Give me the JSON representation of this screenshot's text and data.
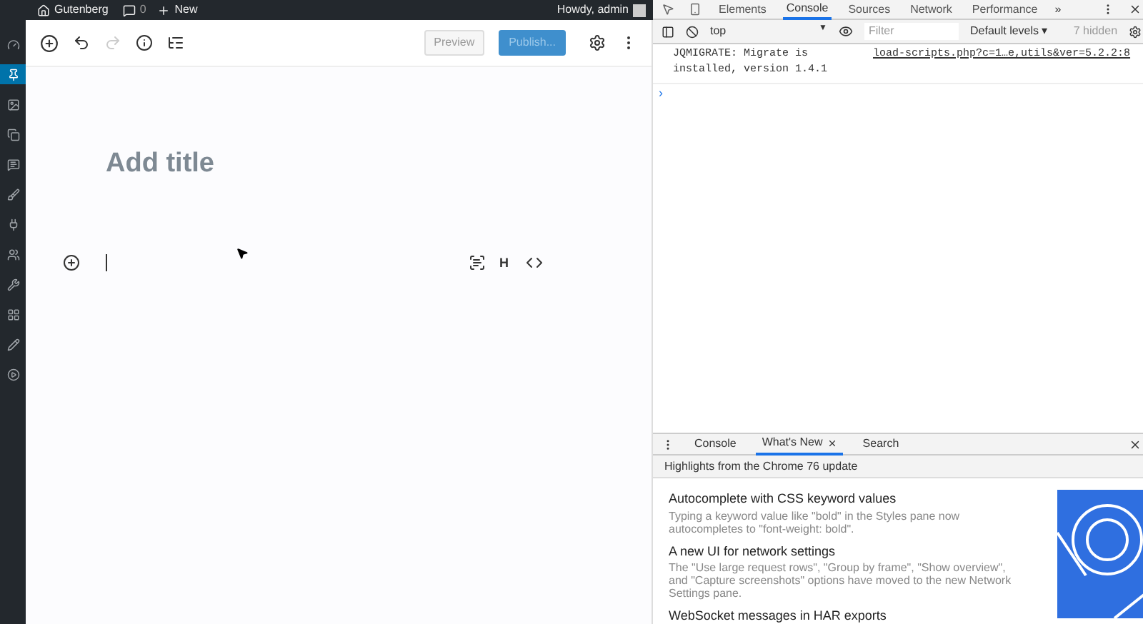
{
  "admin_bar": {
    "site": "Gutenberg",
    "comments": "0",
    "new": "New",
    "greeting": "Howdy, admin"
  },
  "sidebar": {
    "items": [
      {
        "selected": false
      },
      {
        "selected": true
      },
      {
        "selected": false
      },
      {
        "selected": false
      },
      {
        "selected": false
      },
      {
        "selected": false
      },
      {
        "selected": false
      },
      {
        "selected": false
      },
      {
        "selected": false
      },
      {
        "selected": false
      },
      {
        "selected": false
      },
      {
        "selected": false
      }
    ]
  },
  "editor": {
    "toolbar": {
      "redo_disabled": true,
      "preview": "Preview",
      "publish": "Publish..."
    },
    "title_placeholder": "Add title",
    "block_letter": "H"
  },
  "devtools": {
    "tabs": [
      {
        "label": "Elements",
        "selected": false
      },
      {
        "label": "Console",
        "selected": true
      },
      {
        "label": "Sources",
        "selected": false
      },
      {
        "label": "Network",
        "selected": false
      },
      {
        "label": "Performance",
        "selected": false
      }
    ],
    "more": "»",
    "context": "top",
    "context_arrow": "▼",
    "filter_placeholder": "Filter",
    "levels": "Default levels ▾",
    "hidden": "7 hidden",
    "messages": [
      {
        "text": "JQMIGRATE: Migrate is installed, version 1.4.1",
        "source": "load-scripts.php?c=1…e,utils&ver=5.2.2:8"
      }
    ],
    "prompt": "›",
    "drawer_tabs": [
      {
        "label": "Console",
        "selected": false,
        "closable": false
      },
      {
        "label": "What's New",
        "selected": true,
        "closable": true
      },
      {
        "label": "Search",
        "selected": false,
        "closable": false
      }
    ],
    "highlights_title": "Highlights from the Chrome 76 update",
    "articles": [
      {
        "title": "Autocomplete with CSS keyword values",
        "body": "Typing a keyword value like \"bold\" in the Styles pane now autocompletes to \"font-weight: bold\"."
      },
      {
        "title": "A new UI for network settings",
        "body": "The \"Use large request rows\", \"Group by frame\", \"Show overview\", and \"Capture screenshots\" options have moved to the new Network Settings pane."
      },
      {
        "title": "WebSocket messages in HAR exports"
      }
    ]
  }
}
